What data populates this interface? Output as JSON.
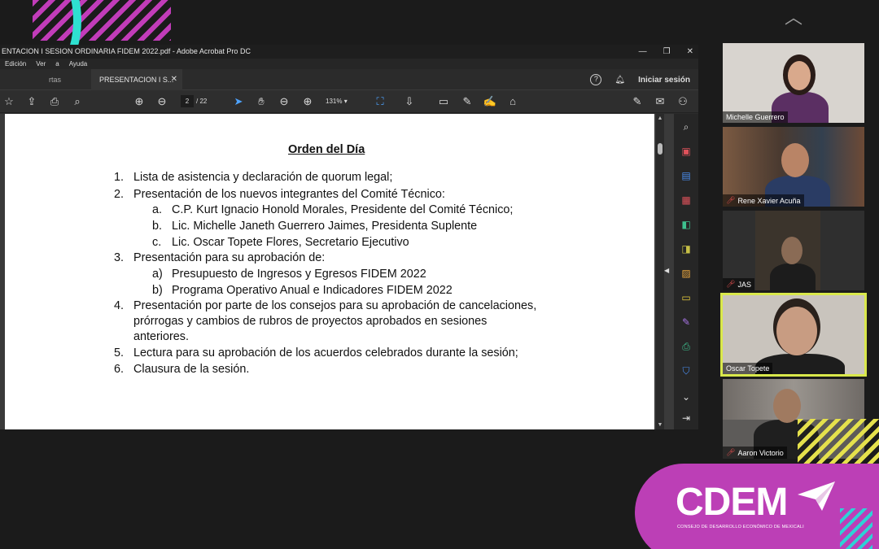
{
  "acrobat": {
    "window_title": "ENTACION I SESION ORDINARIA FIDEM 2022.pdf - Adobe Acrobat Pro DC",
    "menu": [
      "Edición",
      "Ver",
      "a",
      "Ayuda"
    ],
    "tabs": {
      "inactive": "rtas",
      "active": "PRESENTACION I S..."
    },
    "signin": "Iniciar sesión",
    "page_current": "2",
    "page_total": "/ 22",
    "zoom": "131%"
  },
  "document": {
    "title": "Orden del Día",
    "items": [
      {
        "num": "1.",
        "text": "Lista de asistencia y declaración de quorum legal;"
      },
      {
        "num": "2.",
        "text": "Presentación de los nuevos integrantes del Comité Técnico:"
      },
      {
        "num": "a.",
        "text": "C.P. Kurt Ignacio Honold Morales, Presidente del Comité Técnico;"
      },
      {
        "num": "b.",
        "text": "Lic. Michelle Janeth Guerrero Jaimes, Presidenta Suplente"
      },
      {
        "num": "c.",
        "text": "Lic. Oscar Topete Flores, Secretario Ejecutivo"
      },
      {
        "num": "3.",
        "text": "Presentación para su aprobación de:"
      },
      {
        "num": "a)",
        "text": "Presupuesto de Ingresos y Egresos FIDEM 2022"
      },
      {
        "num": "b)",
        "text": "Programa Operativo Anual e Indicadores FIDEM 2022"
      },
      {
        "num": "4.",
        "text": "Presentación por parte de los consejos para su aprobación de cancelaciones,"
      },
      {
        "num": "",
        "text": "prórrogas   y   cambios   de   rubros   de   proyectos   aprobados   en   sesiones"
      },
      {
        "num": "",
        "text": "anteriores."
      },
      {
        "num": "5.",
        "text": "Lectura para su aprobación de los acuerdos celebrados durante la sesión;"
      },
      {
        "num": "6.",
        "text": "Clausura de la sesión."
      }
    ]
  },
  "participants": [
    {
      "name": "Michelle Guerrero",
      "muted": false
    },
    {
      "name": "Rene Xavier Acuña",
      "muted": true
    },
    {
      "name": "JAS",
      "muted": true
    },
    {
      "name": "Oscar Topete",
      "muted": false
    },
    {
      "name": "Aaron Victorio",
      "muted": true
    }
  ],
  "branding": {
    "logo": "CDEM",
    "subtitle": "CONSEJO DE DESARROLLO ECONÓMICO DE MEXICALI"
  },
  "icons": [
    "star-icon",
    "upload-icon",
    "print-icon",
    "zoom-icon",
    "prev-page-icon",
    "next-page-icon",
    "cursor-icon",
    "hand-icon",
    "zoom-out-icon",
    "zoom-in-icon",
    "fit-icon",
    "scroll-mode-icon",
    "comment-icon",
    "pen-icon",
    "sign-icon",
    "tag-icon",
    "help-icon",
    "bell-icon",
    "share-icon",
    "mail-icon",
    "add-user-icon"
  ]
}
